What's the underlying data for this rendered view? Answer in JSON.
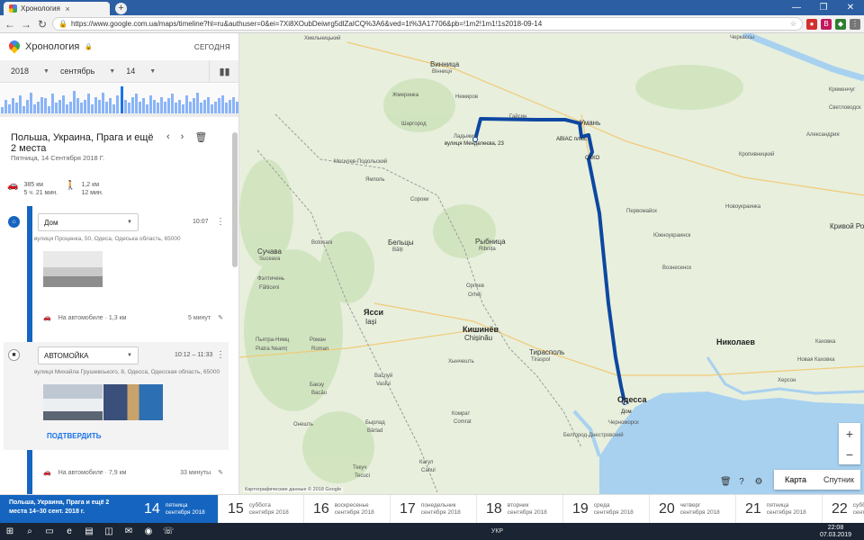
{
  "browser": {
    "tab_title": "Хронология",
    "tab_close": "×",
    "new_tab": "+",
    "url": "https://www.google.com.ua/maps/timeline?hl=ru&authuser=0&ei=7Xi8XOubDeiwrg5dlZaICQ%3A6&ved=1t%3A17706&pb=!1m2!1m1!1s2018-09-14",
    "star": "☆",
    "ext1": "В"
  },
  "sidebar": {
    "title": "Хронология",
    "lock": "🔒",
    "today": "СЕГОДНЯ",
    "year": "2018",
    "month": "сентябрь",
    "day": "14",
    "summary": {
      "title": "Польша, Украина, Прага и ещё 2 места",
      "date": "Пятница, 14 Сентября 2018 Г.",
      "drive": {
        "dist": "385 км",
        "time": "5 ч. 21 мин."
      },
      "walk": {
        "dist": "1,2 км",
        "time": "12 мин."
      }
    },
    "entries": [
      {
        "name": "Дом",
        "time": "10:07",
        "address": "вулиця Проценка, 50, Одеса, Одеська область, 65000"
      },
      {
        "name": "АВТОМОЙКА",
        "time": "10:12 – 11:33",
        "address": "вулиця Михайла Грушевського, 8, Одесса, Одесская область, 65000",
        "action": "ПОДТВЕРДИТЬ"
      }
    ],
    "trips": [
      {
        "label": "На автомобиле · 1,3 км",
        "duration": "5 минут"
      },
      {
        "label": "На автомобиле · 7,9 км",
        "duration": "33 минуты"
      }
    ]
  },
  "histogram": [
    4,
    9,
    6,
    10,
    7,
    12,
    5,
    9,
    14,
    6,
    8,
    11,
    10,
    5,
    13,
    7,
    9,
    12,
    6,
    8,
    15,
    10,
    7,
    9,
    13,
    6,
    11,
    9,
    14,
    8,
    10,
    6,
    12,
    18,
    9,
    7,
    11,
    13,
    8,
    10,
    6,
    12,
    9,
    7,
    11,
    8,
    10,
    13,
    7,
    9,
    6,
    12,
    8,
    10,
    14,
    7,
    9,
    11,
    6,
    8,
    10,
    12,
    7,
    9,
    11,
    8
  ],
  "histogram_active": [
    33
  ],
  "map": {
    "labels": [
      {
        "t": "Хмельницький"
      },
      {
        "t": "Винница"
      },
      {
        "t": "Вінниця"
      },
      {
        "t": "Черкассы"
      },
      {
        "t": "Кременчуг"
      },
      {
        "t": "Светловодск"
      },
      {
        "t": "Немиров"
      },
      {
        "t": "Жмеринка"
      },
      {
        "t": "Гайсин"
      },
      {
        "t": "Шаргород"
      },
      {
        "t": "Ладыжин"
      },
      {
        "t": "Умань"
      },
      {
        "t": "Кропивницкий"
      },
      {
        "t": "Александрия"
      },
      {
        "t": "Могилев-Подольский"
      },
      {
        "t": "Ямполь"
      },
      {
        "t": "Первомайск"
      },
      {
        "t": "Новоукраинка"
      },
      {
        "t": "Бельцы"
      },
      {
        "t": "Bălți"
      },
      {
        "t": "Сороки"
      },
      {
        "t": "Рыбница"
      },
      {
        "t": "Ribnița"
      },
      {
        "t": "Кривой Рог"
      },
      {
        "t": "Вознесенск"
      },
      {
        "t": "Южноукраинск"
      },
      {
        "t": "Сучава"
      },
      {
        "t": "Suceava"
      },
      {
        "t": "Botoșani"
      },
      {
        "t": "Фэлтичень"
      },
      {
        "t": "Fălticeni"
      },
      {
        "t": "Оргеев"
      },
      {
        "t": "Orhei"
      },
      {
        "t": "Ясси"
      },
      {
        "t": "Iași"
      },
      {
        "t": "Кишинёв"
      },
      {
        "t": "Chișinău"
      },
      {
        "t": "Тирасполь"
      },
      {
        "t": "Tiraspol"
      },
      {
        "t": "Николаев"
      },
      {
        "t": "Пьятра-Нямц"
      },
      {
        "t": "Piatra Neamț"
      },
      {
        "t": "Роман"
      },
      {
        "t": "Roman"
      },
      {
        "t": "Бакэу"
      },
      {
        "t": "Bacău"
      },
      {
        "t": "Васлуй"
      },
      {
        "t": "Vaslui"
      },
      {
        "t": "Хынчешть"
      },
      {
        "t": "Одесса"
      },
      {
        "t": "Черноморск"
      },
      {
        "t": "Белгород-Днестровский"
      },
      {
        "t": "Херсон"
      },
      {
        "t": "Бырлад"
      },
      {
        "t": "Bârlad"
      },
      {
        "t": "Онешть"
      },
      {
        "t": "Комрат"
      },
      {
        "t": "Comrat"
      },
      {
        "t": "Кагул"
      },
      {
        "t": "Cahul"
      },
      {
        "t": "Текуч"
      },
      {
        "t": "Tecuci"
      },
      {
        "t": "Каховка"
      },
      {
        "t": "Новая Каховка"
      }
    ],
    "pins": [
      {
        "t": "вулиця Менделеєва, 23"
      },
      {
        "t": "ABIAC плюс"
      },
      {
        "t": "ОККО"
      },
      {
        "t": "Дом"
      }
    ],
    "map_btn": "Карта",
    "sat_btn": "Спутник",
    "zoom_in": "+",
    "zoom_out": "−",
    "attribution": "Картографические данные © 2018 Google"
  },
  "dates": {
    "range": "Польша, Украина, Прага и ещё 2 места 14–30 сент. 2018 г.",
    "days": [
      {
        "n": "14",
        "w": "пятница",
        "m": "сентября 2018"
      },
      {
        "n": "15",
        "w": "суббота",
        "m": "сентября 2018"
      },
      {
        "n": "16",
        "w": "воскресенье",
        "m": "сентября 2018"
      },
      {
        "n": "17",
        "w": "понедельник",
        "m": "сентября 2018"
      },
      {
        "n": "18",
        "w": "вторник",
        "m": "сентября 2018"
      },
      {
        "n": "19",
        "w": "среда",
        "m": "сентября 2018"
      },
      {
        "n": "20",
        "w": "четверг",
        "m": "сентября 2018"
      },
      {
        "n": "21",
        "w": "пятница",
        "m": "сентября 2018"
      },
      {
        "n": "22",
        "w": "суббота",
        "m": "сентября 2018"
      }
    ]
  },
  "taskbar": {
    "time": "22:08",
    "date": "07.03.2019",
    "lang": "УКР"
  }
}
